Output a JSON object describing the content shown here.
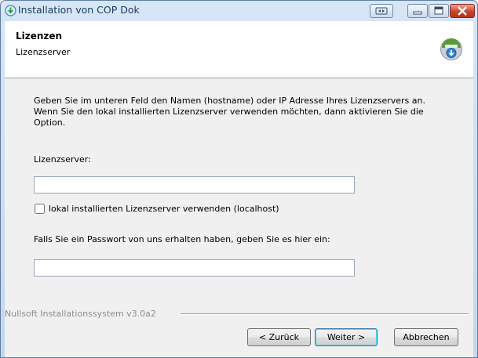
{
  "window": {
    "title": "Installation von COP Dok"
  },
  "header": {
    "title": "Lizenzen",
    "subtitle": "Lizenzserver"
  },
  "body": {
    "description": "Geben Sie im unteren Feld den Namen (hostname) oder IP Adresse Ihres Lizenzservers an. Wenn Sie den lokal installierten Lizenzserver verwenden möchten, dann aktivieren Sie die Option.",
    "server_label": "Lizenzserver:",
    "server_value": "",
    "localhost_label": "lokal installierten Lizenzserver verwenden (localhost)",
    "localhost_checked": false,
    "password_label": "Falls Sie ein Passwort von uns erhalten haben, geben Sie es hier ein:",
    "password_value": ""
  },
  "footer": {
    "branding": "Nullsoft Installationssystem v3.0a2"
  },
  "buttons": {
    "back": "< Zurück",
    "next": "Weiter >",
    "cancel": "Abbrechen"
  },
  "icons": {
    "app": "installer-icon",
    "header": "install-disc-icon"
  }
}
